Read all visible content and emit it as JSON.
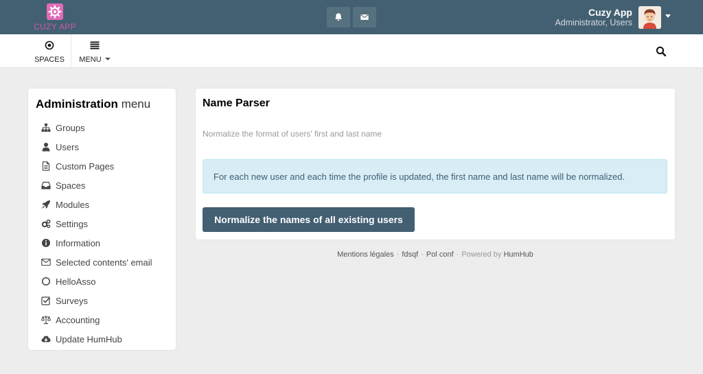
{
  "topbar": {
    "logo_text": "CUZY APP",
    "notifications_icon": "bell-icon",
    "messages_icon": "envelope-icon",
    "user_name": "Cuzy App",
    "user_role": "Administrator, Users"
  },
  "subnav": {
    "spaces_label": "SPACES",
    "menu_label": "MENU"
  },
  "sidebar": {
    "title_bold": "Administration",
    "title_light": "menu",
    "items": [
      {
        "label": "Groups",
        "icon": "sitemap-icon"
      },
      {
        "label": "Users",
        "icon": "user-icon"
      },
      {
        "label": "Custom Pages",
        "icon": "file-icon"
      },
      {
        "label": "Spaces",
        "icon": "inbox-icon"
      },
      {
        "label": "Modules",
        "icon": "rocket-icon"
      },
      {
        "label": "Settings",
        "icon": "gears-icon"
      },
      {
        "label": "Information",
        "icon": "info-circle-icon"
      },
      {
        "label": "Selected contents' email",
        "icon": "envelope-outline-icon"
      },
      {
        "label": "HelloAsso",
        "icon": "circle-outline-icon"
      },
      {
        "label": "Surveys",
        "icon": "check-square-icon"
      },
      {
        "label": "Accounting",
        "icon": "balance-scale-icon"
      },
      {
        "label": "Update HumHub",
        "icon": "cloud-download-icon"
      }
    ]
  },
  "main": {
    "title": "Name Parser",
    "subtitle": "Normalize the format of users' first and last name",
    "alert_text": "For each new user and each time the profile is updated, the first name and last name will be normalized.",
    "button_label": "Normalize the names of all existing users"
  },
  "footer": {
    "link1": "Mentions légales",
    "link2": "fdsqf",
    "link3": "Pol conf",
    "powered_prefix": "Powered by",
    "powered_link": "HumHub"
  },
  "colors": {
    "topbar": "#435f72",
    "accent": "#435f72",
    "alert_bg": "#d9edf7",
    "logo": "#e06cb8"
  }
}
